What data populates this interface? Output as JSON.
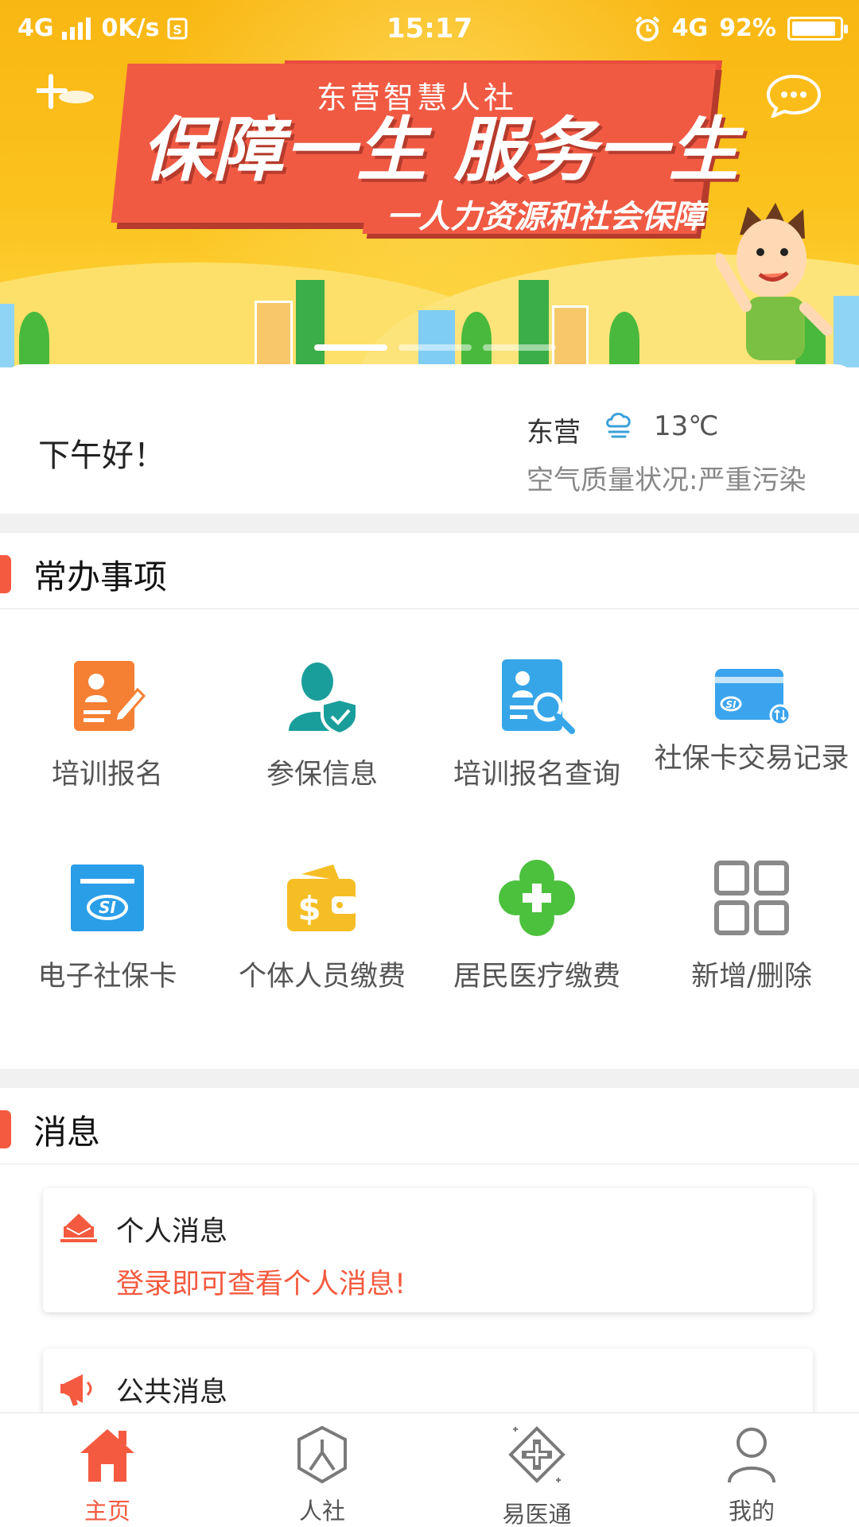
{
  "status_bar": {
    "network": "4G",
    "speed": "0K/s",
    "time": "15:17",
    "network_right": "4G",
    "battery": "92%"
  },
  "banner": {
    "app_name": "东营智慧人社",
    "slogan": "保障一生  服务一生",
    "sub_slogan": "一人力资源和社会保障",
    "slide_count": 3,
    "active_slide": 1
  },
  "greeting": {
    "text": "下午好！",
    "city": "东营",
    "temperature": "13℃",
    "air_quality": "空气质量状况:严重污染"
  },
  "services": {
    "title": "常办事项",
    "items": [
      {
        "label": "培训报名",
        "icon": "training-signup-icon",
        "color": "#f57f33"
      },
      {
        "label": "参保信息",
        "icon": "insured-person-icon",
        "color": "#1a9e9b"
      },
      {
        "label": "培训报名查询",
        "icon": "training-search-icon",
        "color": "#36a6e8"
      },
      {
        "label": "社保卡交易记录",
        "icon": "card-transaction-icon",
        "color": "#3ba4ee"
      },
      {
        "label": "电子社保卡",
        "icon": "e-social-card-icon",
        "color": "#2b9ee8"
      },
      {
        "label": "个体人员缴费",
        "icon": "wallet-icon",
        "color": "#f5be25"
      },
      {
        "label": "居民医疗缴费",
        "icon": "medical-cross-icon",
        "color": "#4cc13e"
      },
      {
        "label": "新增/删除",
        "icon": "grid-icon",
        "color": "#8a8a8a"
      }
    ]
  },
  "messages": {
    "title": "消息",
    "personal": {
      "title": "个人消息",
      "body": "登录即可查看个人消息!"
    },
    "public": {
      "title": "公共消息"
    }
  },
  "nav": {
    "items": [
      {
        "label": "主页",
        "icon": "home-icon"
      },
      {
        "label": "人社",
        "icon": "renshe-icon"
      },
      {
        "label": "易医通",
        "icon": "yiyitong-icon"
      },
      {
        "label": "我的",
        "icon": "profile-icon"
      }
    ]
  },
  "colors": {
    "accent": "#f45a3f",
    "banner_yellow": "#fbc21e",
    "ribbon_red": "#f05a43"
  }
}
